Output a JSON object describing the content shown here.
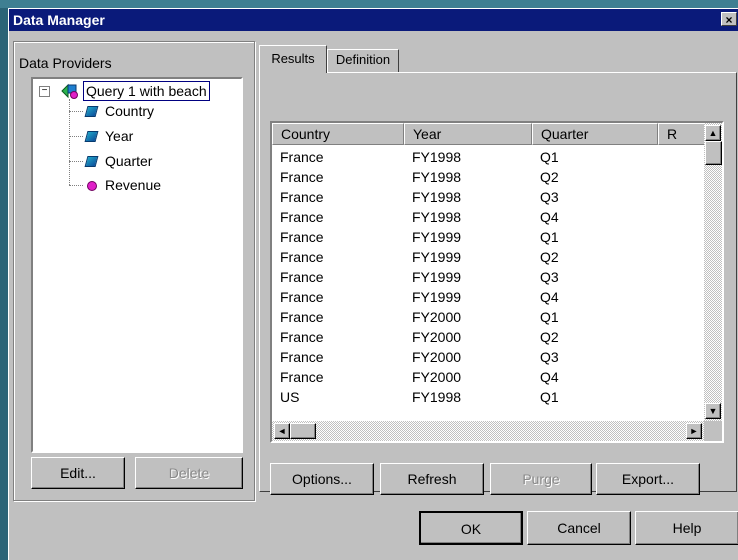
{
  "window": {
    "title": "Data Manager",
    "close_glyph": "×"
  },
  "providers": {
    "group_label": "Data Providers",
    "tree": {
      "root_label": "Query 1 with beach",
      "expander": "−",
      "items": [
        {
          "label": "Country",
          "icon": "dimension-icon"
        },
        {
          "label": "Year",
          "icon": "dimension-icon"
        },
        {
          "label": "Quarter",
          "icon": "dimension-icon"
        },
        {
          "label": "Revenue",
          "icon": "measure-icon"
        }
      ]
    },
    "edit_button": "Edit...",
    "delete_button": "Delete"
  },
  "tabs": [
    {
      "label": "Results",
      "active": true
    },
    {
      "label": "Definition",
      "active": false
    }
  ],
  "results": {
    "columns": [
      "Country",
      "Year",
      "Quarter",
      "R"
    ],
    "rows": [
      [
        "France",
        "FY1998",
        "Q1"
      ],
      [
        "France",
        "FY1998",
        "Q2"
      ],
      [
        "France",
        "FY1998",
        "Q3"
      ],
      [
        "France",
        "FY1998",
        "Q4"
      ],
      [
        "France",
        "FY1999",
        "Q1"
      ],
      [
        "France",
        "FY1999",
        "Q2"
      ],
      [
        "France",
        "FY1999",
        "Q3"
      ],
      [
        "France",
        "FY1999",
        "Q4"
      ],
      [
        "France",
        "FY2000",
        "Q1"
      ],
      [
        "France",
        "FY2000",
        "Q2"
      ],
      [
        "France",
        "FY2000",
        "Q3"
      ],
      [
        "France",
        "FY2000",
        "Q4"
      ],
      [
        "US",
        "FY1998",
        "Q1"
      ]
    ],
    "scroll": {
      "up": "▲",
      "down": "▼",
      "left": "◄",
      "right": "►"
    }
  },
  "actions": {
    "options": "Options...",
    "refresh": "Refresh",
    "purge": "Purge",
    "export": "Export..."
  },
  "footer": {
    "ok": "OK",
    "cancel": "Cancel",
    "help": "Help"
  },
  "colors": {
    "titlebar": "#0a1a7a",
    "desktop": "#2b6477",
    "face": "#c0c0c0"
  }
}
